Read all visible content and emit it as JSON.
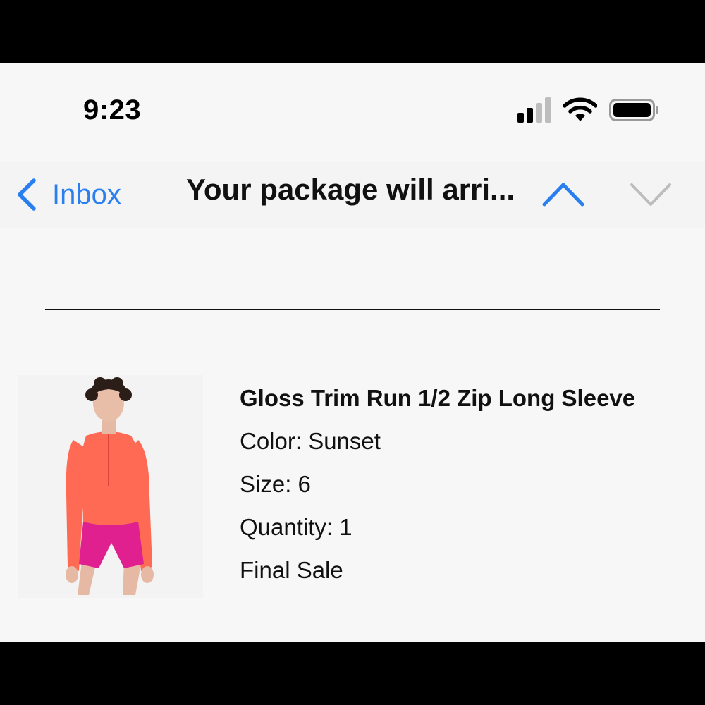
{
  "status_bar": {
    "time": "9:23"
  },
  "navbar": {
    "back_label": "Inbox",
    "title": "Your package will arri..."
  },
  "product": {
    "name": "Gloss Trim Run 1/2 Zip Long Sleeve",
    "color": "Color: Sunset",
    "size": "Size: 6",
    "quantity": "Quantity: 1",
    "sale_note": "Final Sale"
  },
  "colors": {
    "accent": "#2a7ff0",
    "top_color": "#ff6a55",
    "shorts_color": "#e0208f"
  },
  "icons": [
    "cellular-signal-icon",
    "wifi-icon",
    "battery-icon",
    "chevron-left-icon",
    "chevron-up-icon",
    "chevron-down-icon"
  ]
}
